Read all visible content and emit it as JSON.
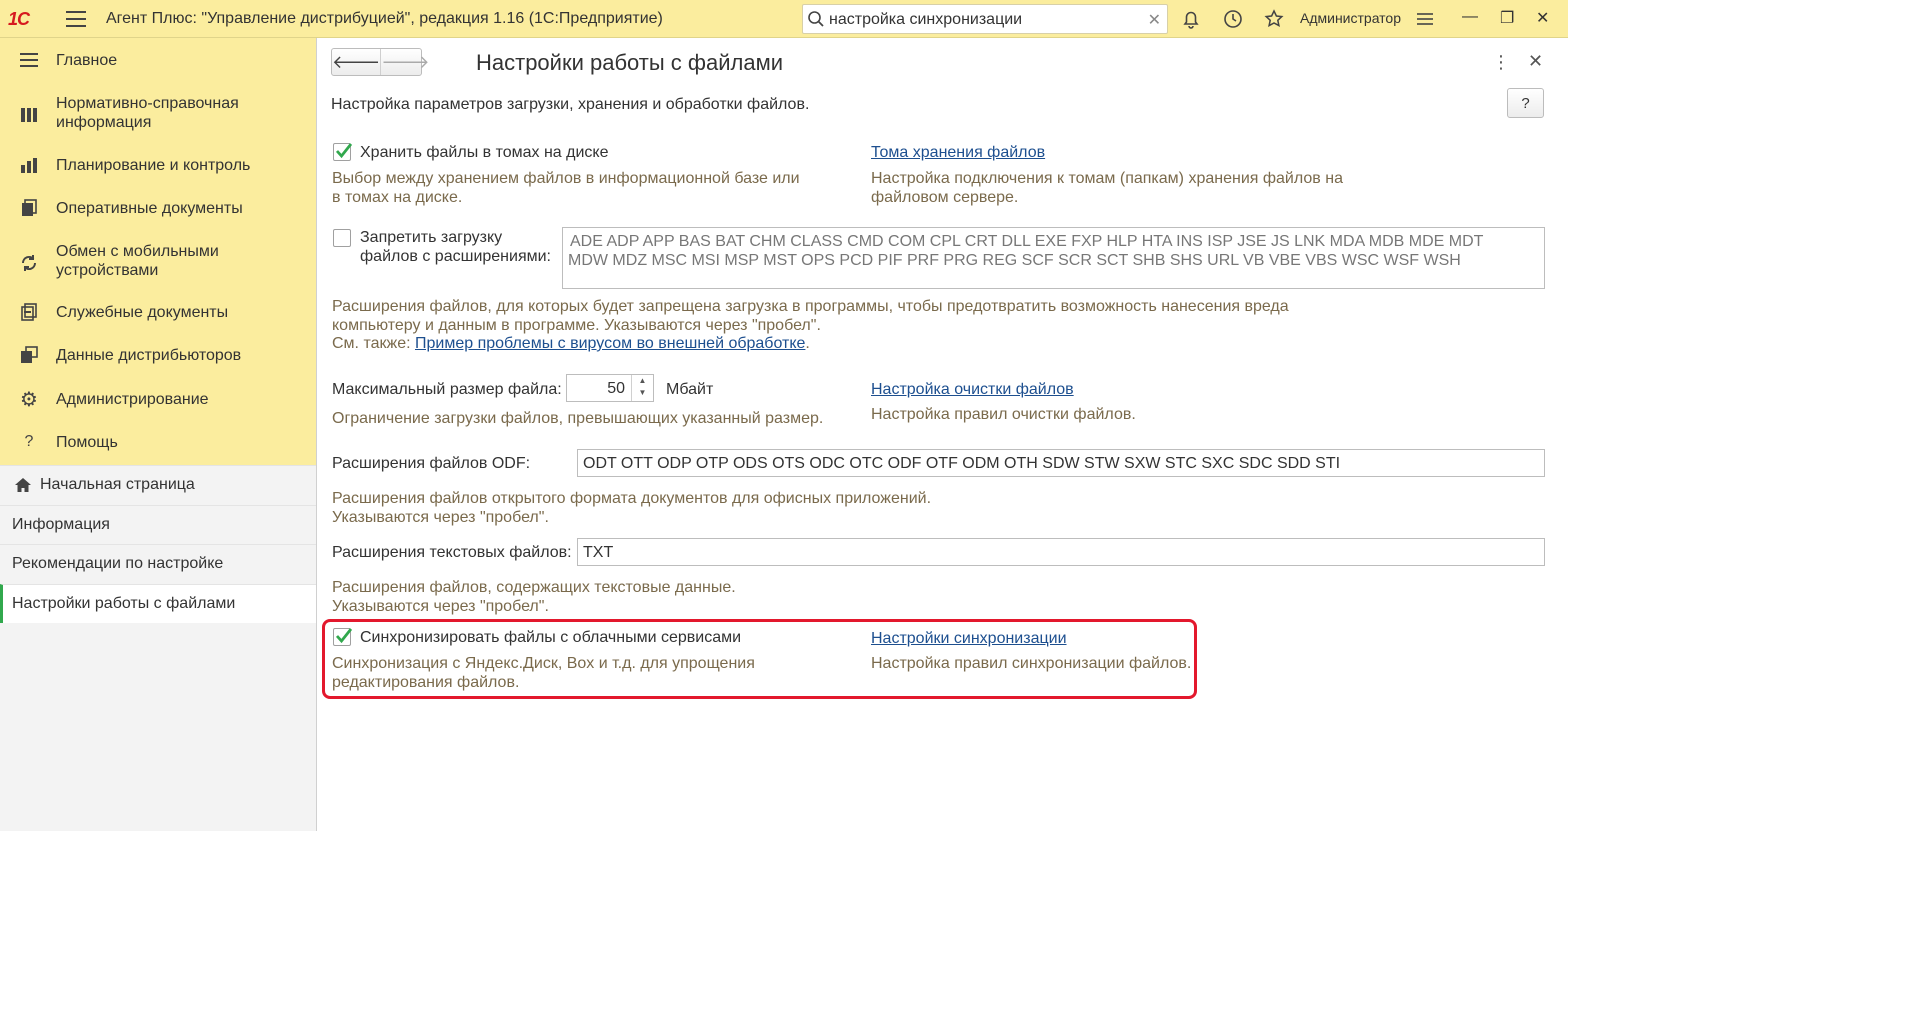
{
  "app": {
    "logo": "1С",
    "title": "Агент Плюс: \"Управление дистрибуцией\", редакция 1.16  (1С:Предприятие)",
    "search_value": "настройка синхронизации",
    "user": "Администратор"
  },
  "sidebar": {
    "sections": [
      {
        "label": "Главное",
        "icon": "menu-lines-icon"
      },
      {
        "label": "Нормативно-справочная информация",
        "icon": "grid-icon"
      },
      {
        "label": "Планирование и контроль",
        "icon": "bar-chart-icon"
      },
      {
        "label": "Оперативные документы",
        "icon": "documents-icon"
      },
      {
        "label": "Обмен с мобильными устройствами",
        "icon": "sync-icon"
      },
      {
        "label": "Служебные документы",
        "icon": "service-docs-icon"
      },
      {
        "label": "Данные дистрибьюторов",
        "icon": "distributor-data-icon"
      },
      {
        "label": "Администрирование",
        "icon": "gear-icon"
      },
      {
        "label": "Помощь",
        "icon": "question-icon"
      }
    ],
    "open_windows": [
      {
        "label": "Начальная страница"
      },
      {
        "label": "Информация"
      },
      {
        "label": "Рекомендации по настройке"
      },
      {
        "label": "Настройки работы с файлами"
      }
    ]
  },
  "main": {
    "title": "Настройки работы с файлами",
    "subtitle": "Настройка параметров загрузки, хранения и обработки файлов.",
    "help_label": "?",
    "store_in_volumes": {
      "checked": true,
      "label": "Хранить файлы в томах на диске",
      "hint1": "Выбор между хранением файлов в информационной базе или",
      "hint2": "в томах на диске.",
      "link": "Тома хранения файлов",
      "link_hint1": "Настройка подключения к томам (папкам) хранения файлов на",
      "link_hint2": "файловом сервере."
    },
    "forbid_upload": {
      "checked": false,
      "label1": "Запретить загрузку",
      "label2": "файлов с расширениями:",
      "value1": "ADE ADP APP BAS BAT CHM CLASS CMD COM CPL CRT DLL EXE FXP HLP HTA INS ISP JSE JS LNK MDA MDB MDE MDT",
      "value2": "MDW MDZ MSC MSI MSP MST OPS PCD PIF PRF PRG REG SCF SCR SCT SHB SHS URL VB VBE VBS WSC WSF WSH",
      "hint1": "Расширения файлов, для которых будет запрещена загрузка в  программы, чтобы предотвратить возможность нанесения вреда",
      "hint2": "компьютеру и  данным в программе. Указываются через \"пробел\".",
      "see_also": "См. также: ",
      "see_also_link": "Пример проблемы с вирусом во внешней  обработке",
      "see_also_end": "."
    },
    "max_size": {
      "label": "Максимальный размер файла:",
      "value": "50",
      "unit": "Мбайт",
      "hint": "Ограничение загрузки файлов, превышающих указанный размер.",
      "link": "Настройка очистки файлов",
      "link_hint": "Настройка правил очистки файлов."
    },
    "odf": {
      "label": "Расширения файлов ODF:",
      "value": "ODT OTT ODP OTP ODS OTS ODC OTC ODF OTF ODM OTH SDW STW SXW STC SXC SDC SDD STI",
      "hint1": "Расширения файлов открытого формата документов для офисных приложений.",
      "hint2": "Указываются через \"пробел\"."
    },
    "text_ext": {
      "label": "Расширения текстовых файлов:",
      "value": "TXT",
      "hint1": "Расширения файлов, содержащих текстовые данные.",
      "hint2": "Указываются через \"пробел\"."
    },
    "cloud_sync": {
      "checked": true,
      "label": "Синхронизировать файлы с облачными сервисами",
      "hint1": "Синхронизация с Яндекс.Диск, Box и т.д. для упрощения",
      "hint2": "редактирования файлов.",
      "link": "Настройки синхронизации",
      "link_hint": "Настройка правил синхронизации файлов."
    }
  },
  "colors": {
    "topbar_bg": "#fbed9e",
    "hint_text": "#7a6a4c",
    "link": "#1d4f8f",
    "check": "#31a84d",
    "highlight": "#e3182d"
  }
}
